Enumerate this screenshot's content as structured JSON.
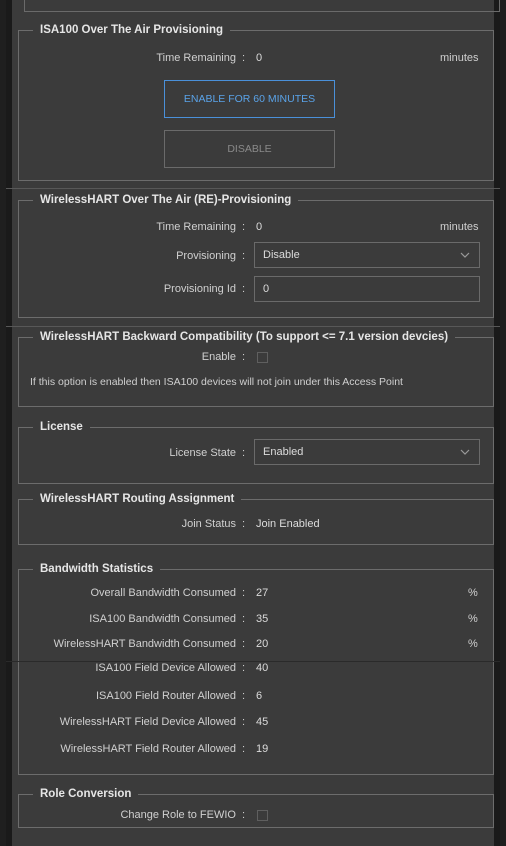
{
  "isa100_ota": {
    "legend": "ISA100 Over The Air Provisioning",
    "time_remaining_label": "Time Remaining",
    "time_remaining_value": "0",
    "time_remaining_unit": "minutes",
    "enable_button": "ENABLE FOR 60 MINUTES",
    "disable_button": "DISABLE"
  },
  "whart_ota": {
    "legend": "WirelessHART Over The Air (RE)-Provisioning",
    "time_remaining_label": "Time Remaining",
    "time_remaining_value": "0",
    "time_remaining_unit": "minutes",
    "provisioning_label": "Provisioning",
    "provisioning_value": "Disable",
    "provisioning_id_label": "Provisioning Id",
    "provisioning_id_value": "0"
  },
  "whart_backward": {
    "legend": "WirelessHART Backward Compatibility (To support <= 7.1 version devcies)",
    "enable_label": "Enable",
    "enabled": false,
    "note": "If this option is enabled then ISA100 devices will not join under this Access Point"
  },
  "license": {
    "legend": "License",
    "state_label": "License State",
    "state_value": "Enabled"
  },
  "routing": {
    "legend": "WirelessHART Routing Assignment",
    "join_status_label": "Join Status",
    "join_status_value": "Join Enabled"
  },
  "bandwidth": {
    "legend": "Bandwidth Statistics",
    "rows": [
      {
        "label": "Overall Bandwidth Consumed",
        "value": "27",
        "unit": "%"
      },
      {
        "label": "ISA100 Bandwidth Consumed",
        "value": "35",
        "unit": "%"
      },
      {
        "label": "WirelessHART Bandwidth Consumed",
        "value": "20",
        "unit": "%"
      },
      {
        "label": "ISA100 Field Device Allowed",
        "value": "40"
      },
      {
        "label": "ISA100 Field Router Allowed",
        "value": "6"
      },
      {
        "label": "WirelessHART Field Device Allowed",
        "value": "45"
      },
      {
        "label": "WirelessHART Field Router Allowed",
        "value": "19"
      }
    ]
  },
  "role": {
    "legend": "Role Conversion",
    "change_label": "Change Role to FEWIO",
    "checked": false
  },
  "separator": ":",
  "colors": {
    "accent": "#4a90d9",
    "panel": "#3b3b3b",
    "border": "#6c6c6c"
  },
  "icons": {
    "dropdown": "chevron-down-icon"
  }
}
